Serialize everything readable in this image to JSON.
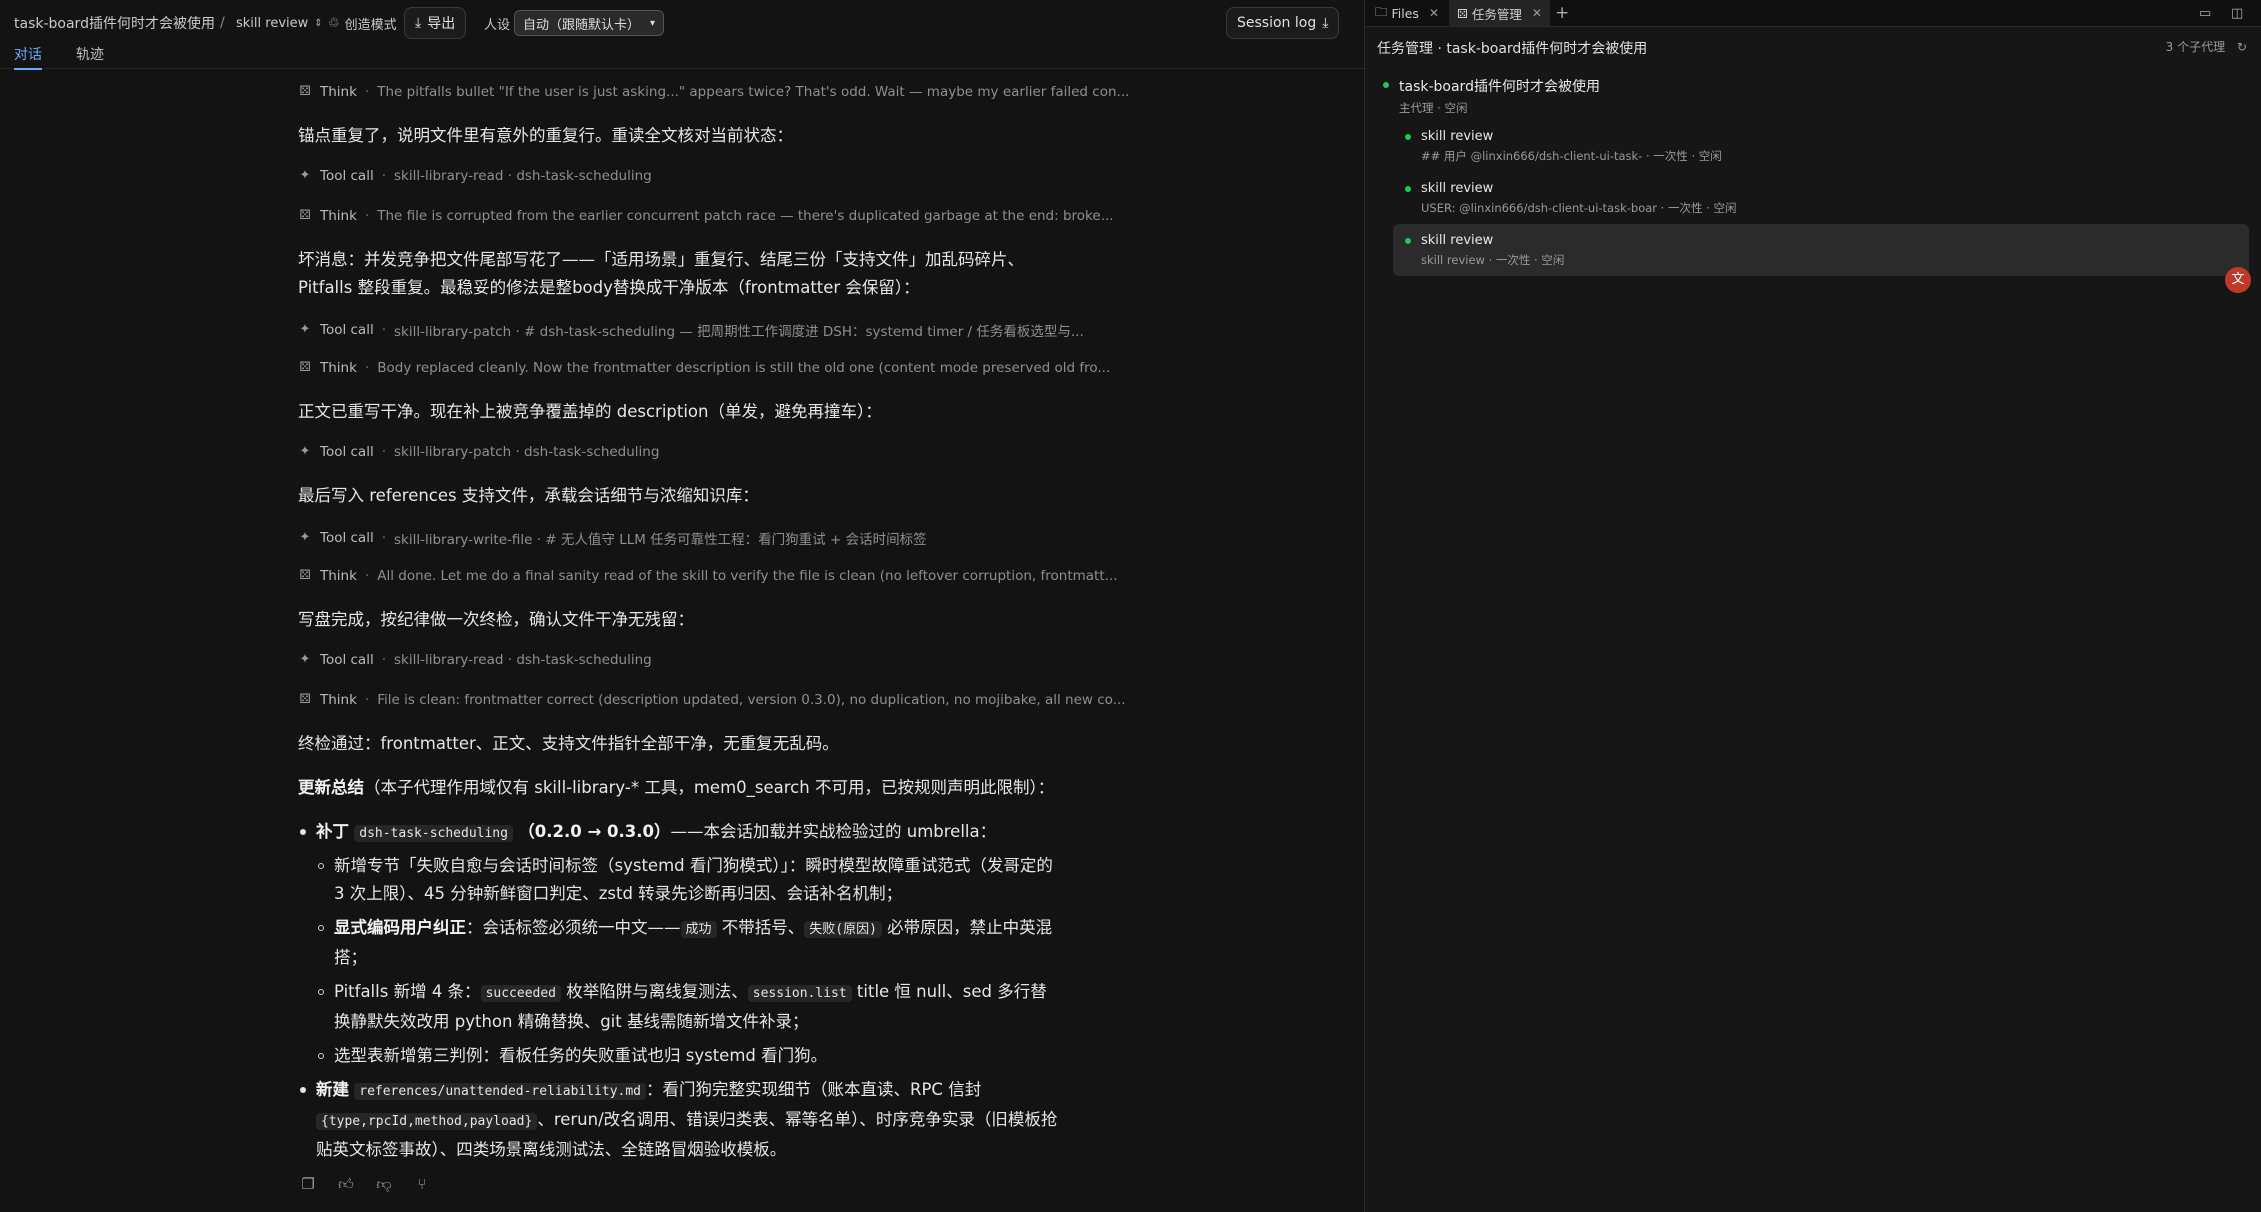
{
  "topbar": {
    "title": "task-board插件何时才会被使用",
    "separator": "/",
    "skill_label": "skill review",
    "create_mode": "创造模式",
    "export": "导出",
    "persona_label": "人设",
    "persona_value": "自动（跟随默认卡）",
    "session_log": "Session log"
  },
  "subtabs": [
    {
      "label": "对话"
    },
    {
      "label": "轨迹"
    }
  ],
  "chat": {
    "think1": {
      "label": "Think",
      "text": "The pitfalls bullet \"If the user is just asking...\" appears twice? That's odd. Wait — maybe my earlier failed con..."
    },
    "p1": "锚点重复了，说明文件里有意外的重复行。重读全文核对当前状态：",
    "tool1": {
      "label": "Tool call",
      "text": "skill-library-read · dsh-task-scheduling"
    },
    "think2": {
      "label": "Think",
      "text": "The file is corrupted from the earlier concurrent patch race — there's duplicated garbage at the end: broke..."
    },
    "p2a": "坏消息：并发竞争把文件尾部写花了——「适用场景」重复行、结尾三份「支持文件」加乱码碎片、",
    "p2b": "Pitfalls 整段重复。最稳妥的修法是整body替换成干净版本（frontmatter 会保留）：",
    "tool2": {
      "label": "Tool call",
      "text": "skill-library-patch · # dsh-task-scheduling — 把周期性工作调度进 DSH：systemd timer / 任务看板选型与..."
    },
    "think3": {
      "label": "Think",
      "text": "Body replaced cleanly. Now the frontmatter description is still the old one (content mode preserved old fro..."
    },
    "p3": "正文已重写干净。现在补上被竞争覆盖掉的 description（单发，避免再撞车）：",
    "tool3": {
      "label": "Tool call",
      "text": "skill-library-patch · dsh-task-scheduling"
    },
    "p4": "最后写入 references 支持文件，承载会话细节与浓缩知识库：",
    "tool4": {
      "label": "Tool call",
      "text": "skill-library-write-file · # 无人值守 LLM 任务可靠性工程：看门狗重试 + 会话时间标签"
    },
    "think4": {
      "label": "Think",
      "text": "All done. Let me do a final sanity read of the skill to verify the file is clean (no leftover corruption, frontmatt..."
    },
    "p5": "写盘完成，按纪律做一次终检，确认文件干净无残留：",
    "tool5": {
      "label": "Tool call",
      "text": "skill-library-read · dsh-task-scheduling"
    },
    "think5": {
      "label": "Think",
      "text": "File is clean: frontmatter correct (description updated, version 0.3.0), no duplication, no mojibake, all new co..."
    },
    "p6": "终检通过：frontmatter、正文、支持文件指针全部干净，无重复无乱码。",
    "summary_bold": "更新总结",
    "summary_rest": "（本子代理作用域仅有 skill-library-* 工具，mem0_search 不可用，已按规则声明此限制）：",
    "b1": {
      "lead": "补丁",
      "code": "dsh-task-scheduling",
      "ver": "（0.2.0 → 0.3.0）",
      "rest": "——本会话加载并实战检验过的 umbrella："
    },
    "b1s1": "新增专节「失败自愈与会话时间标签（systemd 看门狗模式）」：瞬时模型故障重试范式（发哥定的 3 次上限）、45 分钟新鲜窗口判定、zstd 转录先诊断再归因、会话补名机制；",
    "b1s2": {
      "lead": "显式编码用户纠正",
      "a": "：会话标签必须统一中文——",
      "c1": "成功",
      "b": " 不带括号、",
      "c2": "失败(原因)",
      "c": " 必带原因，禁止中英混搭；"
    },
    "b1s3": {
      "a": "Pitfalls 新增 4 条：",
      "c1": "succeeded",
      "b": " 枚举陷阱与离线复测法、",
      "c2": "session.list",
      "c": " title 恒 null、sed 多行替换静默失效改用 python 精确替换、git 基线需随新增文件补录；"
    },
    "b1s4": "选型表新增第三判例：看板任务的失败重试也归 systemd 看门狗。",
    "b2": {
      "lead": "新建",
      "code": "references/unattended-reliability.md",
      "a": "：看门狗完整实现细节（账本直读、RPC 信封 ",
      "c2": "{type,rpcId,method,payload}",
      "b": "、rerun/改名调用、错误归类表、幂等名单）、时序竞争实录（旧模板抢贴英文标签事故）、四类场景离线测试法、全链路冒烟验收模板。"
    }
  },
  "right": {
    "tabs": [
      {
        "label": "Files"
      },
      {
        "label": "任务管理"
      }
    ],
    "add_tab": "+",
    "header": "任务管理 · task-board插件何时才会被使用",
    "count": "3 个子代理",
    "tasks": [
      {
        "title": "task-board插件何时才会被使用",
        "sub": "主代理 · 空闲"
      },
      {
        "title": "skill review",
        "sub": "## 用户 @linxin666/dsh-client-ui-task- · 一次性 · 空闲"
      },
      {
        "title": "skill review",
        "sub": "USER: @linxin666/dsh-client-ui-task-boar · 一次性 · 空闲"
      },
      {
        "title": "skill review",
        "sub": "skill review · 一次性 · 空闲"
      }
    ],
    "avatar_glyph": "文"
  },
  "colors": {
    "accent": "#6aa7ff",
    "status_green": "#22c55e"
  }
}
